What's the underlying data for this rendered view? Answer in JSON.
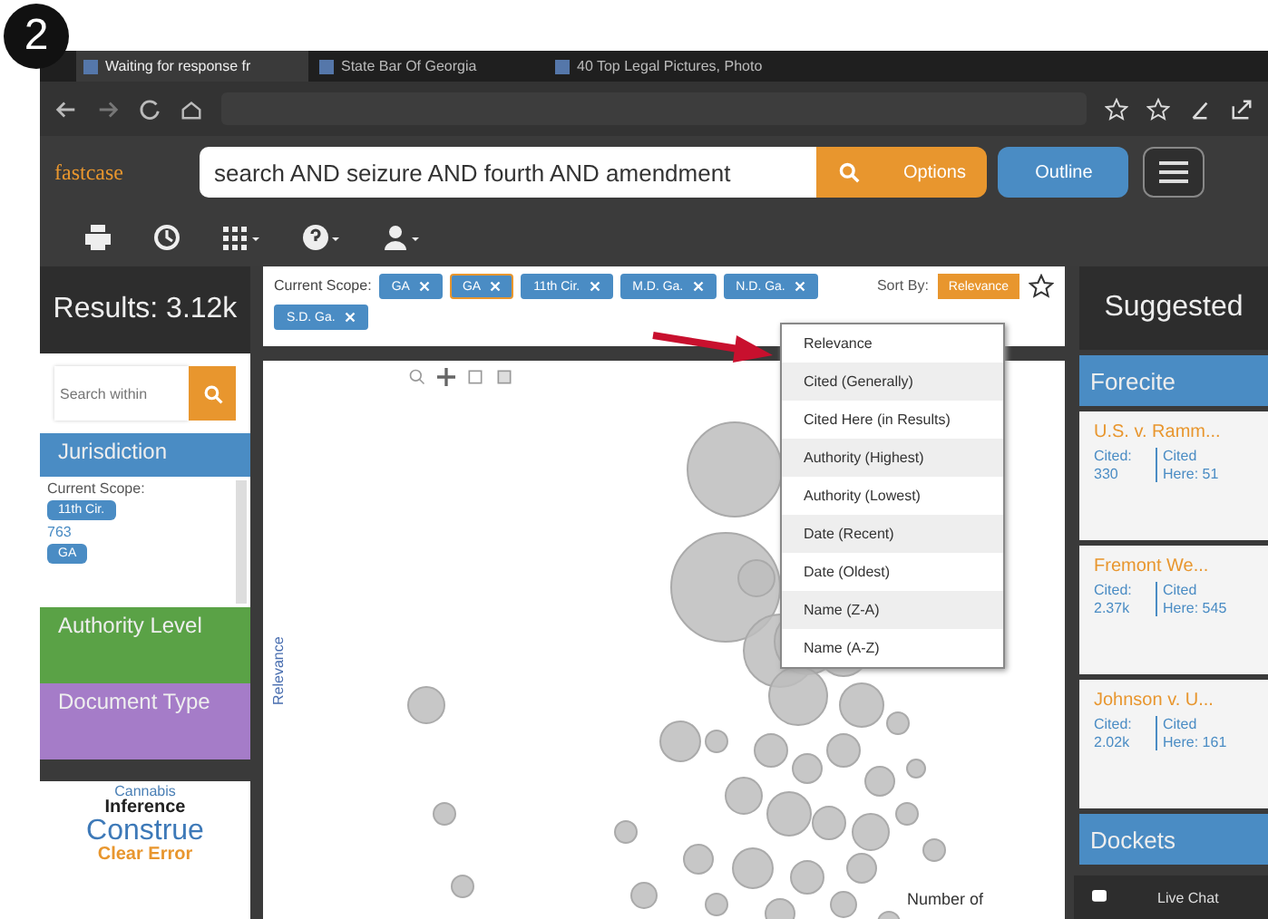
{
  "badge": "2",
  "browser": {
    "tabs": [
      {
        "title": "Waiting for response fr",
        "selected": true
      },
      {
        "title": "State Bar Of Georgia",
        "selected": false
      },
      {
        "title": "40 Top Legal Pictures, Photo",
        "selected": false
      }
    ]
  },
  "app": {
    "logo": "fastcase",
    "search": {
      "value": "search AND seizure AND fourth AND amendment"
    },
    "buttons": [
      {
        "kind": "options",
        "label": "Options"
      },
      {
        "kind": "outline",
        "label": "Outline"
      }
    ]
  },
  "results": {
    "title": "Results: 3.12k",
    "search_placeholder": "Search within",
    "sections": [
      {
        "title": "Jurisdiction",
        "color": "#4a8cc4"
      },
      {
        "title": "Authority Level",
        "color": "#5aa246"
      },
      {
        "title": "Document Type",
        "color": "#a57cc8"
      }
    ],
    "scope_label": "Current Scope:",
    "scope_tags": [
      {
        "label": "11th Cir.",
        "count": "763"
      },
      {
        "label": "GA"
      }
    ],
    "word_cloud": [
      {
        "text": "Cannabis",
        "kind": "small",
        "color": "#4a7fb5"
      },
      {
        "text": "Inference",
        "kind": "medium",
        "color": "#222222"
      },
      {
        "text": "Construe",
        "kind": "large",
        "color": "#3d79b8"
      },
      {
        "text": "Clear Error",
        "kind": "medium",
        "color": "#e8962e"
      }
    ]
  },
  "scope": {
    "label": "Current Scope:",
    "tags": [
      {
        "label": "GA",
        "selected": false
      },
      {
        "label": "GA",
        "selected": true
      },
      {
        "label": "11th Cir.",
        "selected": false
      },
      {
        "label": "M.D. Ga.",
        "selected": false
      },
      {
        "label": "N.D. Ga.",
        "selected": false
      },
      {
        "label": "S.D. Ga.",
        "selected": false
      }
    ]
  },
  "sort": {
    "label": "Sort By:",
    "value": "Relevance",
    "options": [
      "Relevance",
      "Cited (Generally)",
      "Cited Here (in Results)",
      "Authority (Highest)",
      "Authority (Lowest)",
      "Date (Recent)",
      "Date (Oldest)",
      "Name (Z-A)",
      "Name (A-Z)"
    ]
  },
  "chart": {
    "ylabel": "Relevance",
    "xlabel": "Number of"
  },
  "suggested": {
    "title": "Suggested",
    "section": "Forecite",
    "cards": [
      {
        "title": "U.S. v. Ramm...",
        "cited_label": "Cited:",
        "cited": "330",
        "here_label": "Cited Here:",
        "here": "51"
      },
      {
        "title": "Fremont We...",
        "cited_label": "Cited:",
        "cited": "2.37k",
        "here_label": "Cited Here:",
        "here": "545"
      },
      {
        "title": "Johnson v. U...",
        "cited_label": "Cited:",
        "cited": "2.02k",
        "here_label": "Cited Here:",
        "here": "161"
      }
    ],
    "footer": "Dockets"
  },
  "live_chat": "Live Chat"
}
